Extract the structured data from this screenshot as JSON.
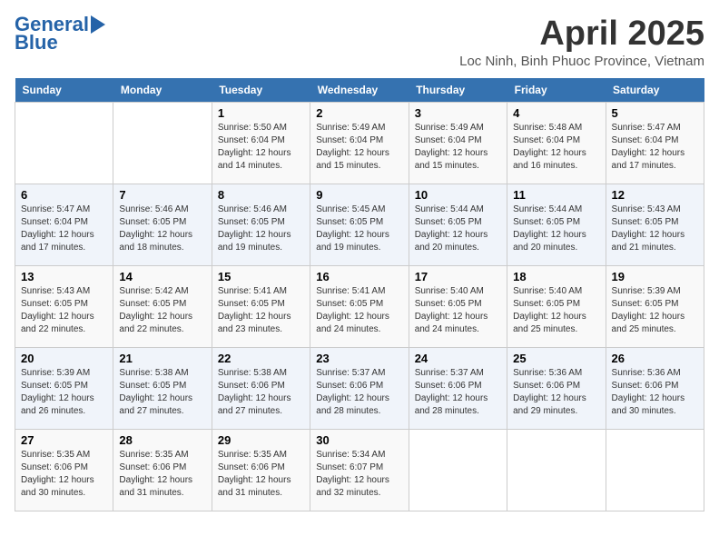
{
  "header": {
    "logo_line1": "General",
    "logo_line2": "Blue",
    "month": "April 2025",
    "location": "Loc Ninh, Binh Phuoc Province, Vietnam"
  },
  "calendar": {
    "weekdays": [
      "Sunday",
      "Monday",
      "Tuesday",
      "Wednesday",
      "Thursday",
      "Friday",
      "Saturday"
    ],
    "weeks": [
      [
        {
          "num": "",
          "info": ""
        },
        {
          "num": "",
          "info": ""
        },
        {
          "num": "1",
          "info": "Sunrise: 5:50 AM\nSunset: 6:04 PM\nDaylight: 12 hours and 14 minutes."
        },
        {
          "num": "2",
          "info": "Sunrise: 5:49 AM\nSunset: 6:04 PM\nDaylight: 12 hours and 15 minutes."
        },
        {
          "num": "3",
          "info": "Sunrise: 5:49 AM\nSunset: 6:04 PM\nDaylight: 12 hours and 15 minutes."
        },
        {
          "num": "4",
          "info": "Sunrise: 5:48 AM\nSunset: 6:04 PM\nDaylight: 12 hours and 16 minutes."
        },
        {
          "num": "5",
          "info": "Sunrise: 5:47 AM\nSunset: 6:04 PM\nDaylight: 12 hours and 17 minutes."
        }
      ],
      [
        {
          "num": "6",
          "info": "Sunrise: 5:47 AM\nSunset: 6:04 PM\nDaylight: 12 hours and 17 minutes."
        },
        {
          "num": "7",
          "info": "Sunrise: 5:46 AM\nSunset: 6:05 PM\nDaylight: 12 hours and 18 minutes."
        },
        {
          "num": "8",
          "info": "Sunrise: 5:46 AM\nSunset: 6:05 PM\nDaylight: 12 hours and 19 minutes."
        },
        {
          "num": "9",
          "info": "Sunrise: 5:45 AM\nSunset: 6:05 PM\nDaylight: 12 hours and 19 minutes."
        },
        {
          "num": "10",
          "info": "Sunrise: 5:44 AM\nSunset: 6:05 PM\nDaylight: 12 hours and 20 minutes."
        },
        {
          "num": "11",
          "info": "Sunrise: 5:44 AM\nSunset: 6:05 PM\nDaylight: 12 hours and 20 minutes."
        },
        {
          "num": "12",
          "info": "Sunrise: 5:43 AM\nSunset: 6:05 PM\nDaylight: 12 hours and 21 minutes."
        }
      ],
      [
        {
          "num": "13",
          "info": "Sunrise: 5:43 AM\nSunset: 6:05 PM\nDaylight: 12 hours and 22 minutes."
        },
        {
          "num": "14",
          "info": "Sunrise: 5:42 AM\nSunset: 6:05 PM\nDaylight: 12 hours and 22 minutes."
        },
        {
          "num": "15",
          "info": "Sunrise: 5:41 AM\nSunset: 6:05 PM\nDaylight: 12 hours and 23 minutes."
        },
        {
          "num": "16",
          "info": "Sunrise: 5:41 AM\nSunset: 6:05 PM\nDaylight: 12 hours and 24 minutes."
        },
        {
          "num": "17",
          "info": "Sunrise: 5:40 AM\nSunset: 6:05 PM\nDaylight: 12 hours and 24 minutes."
        },
        {
          "num": "18",
          "info": "Sunrise: 5:40 AM\nSunset: 6:05 PM\nDaylight: 12 hours and 25 minutes."
        },
        {
          "num": "19",
          "info": "Sunrise: 5:39 AM\nSunset: 6:05 PM\nDaylight: 12 hours and 25 minutes."
        }
      ],
      [
        {
          "num": "20",
          "info": "Sunrise: 5:39 AM\nSunset: 6:05 PM\nDaylight: 12 hours and 26 minutes."
        },
        {
          "num": "21",
          "info": "Sunrise: 5:38 AM\nSunset: 6:05 PM\nDaylight: 12 hours and 27 minutes."
        },
        {
          "num": "22",
          "info": "Sunrise: 5:38 AM\nSunset: 6:06 PM\nDaylight: 12 hours and 27 minutes."
        },
        {
          "num": "23",
          "info": "Sunrise: 5:37 AM\nSunset: 6:06 PM\nDaylight: 12 hours and 28 minutes."
        },
        {
          "num": "24",
          "info": "Sunrise: 5:37 AM\nSunset: 6:06 PM\nDaylight: 12 hours and 28 minutes."
        },
        {
          "num": "25",
          "info": "Sunrise: 5:36 AM\nSunset: 6:06 PM\nDaylight: 12 hours and 29 minutes."
        },
        {
          "num": "26",
          "info": "Sunrise: 5:36 AM\nSunset: 6:06 PM\nDaylight: 12 hours and 30 minutes."
        }
      ],
      [
        {
          "num": "27",
          "info": "Sunrise: 5:35 AM\nSunset: 6:06 PM\nDaylight: 12 hours and 30 minutes."
        },
        {
          "num": "28",
          "info": "Sunrise: 5:35 AM\nSunset: 6:06 PM\nDaylight: 12 hours and 31 minutes."
        },
        {
          "num": "29",
          "info": "Sunrise: 5:35 AM\nSunset: 6:06 PM\nDaylight: 12 hours and 31 minutes."
        },
        {
          "num": "30",
          "info": "Sunrise: 5:34 AM\nSunset: 6:07 PM\nDaylight: 12 hours and 32 minutes."
        },
        {
          "num": "",
          "info": ""
        },
        {
          "num": "",
          "info": ""
        },
        {
          "num": "",
          "info": ""
        }
      ]
    ]
  }
}
